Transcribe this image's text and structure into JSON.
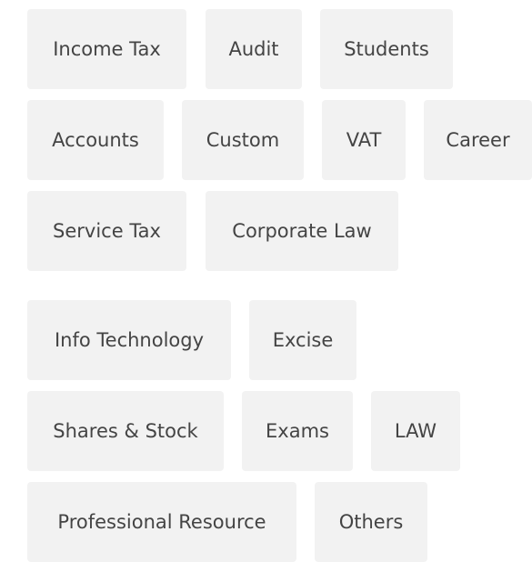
{
  "tag_group_1": [
    "Income Tax",
    "Audit",
    "Students",
    "Accounts",
    "Custom",
    "VAT",
    "Career",
    "Service Tax",
    "Corporate Law"
  ],
  "tag_group_2": [
    "Info Technology",
    "Excise",
    "Shares & Stock",
    "Exams",
    "LAW",
    "Professional Resource",
    "Others"
  ]
}
